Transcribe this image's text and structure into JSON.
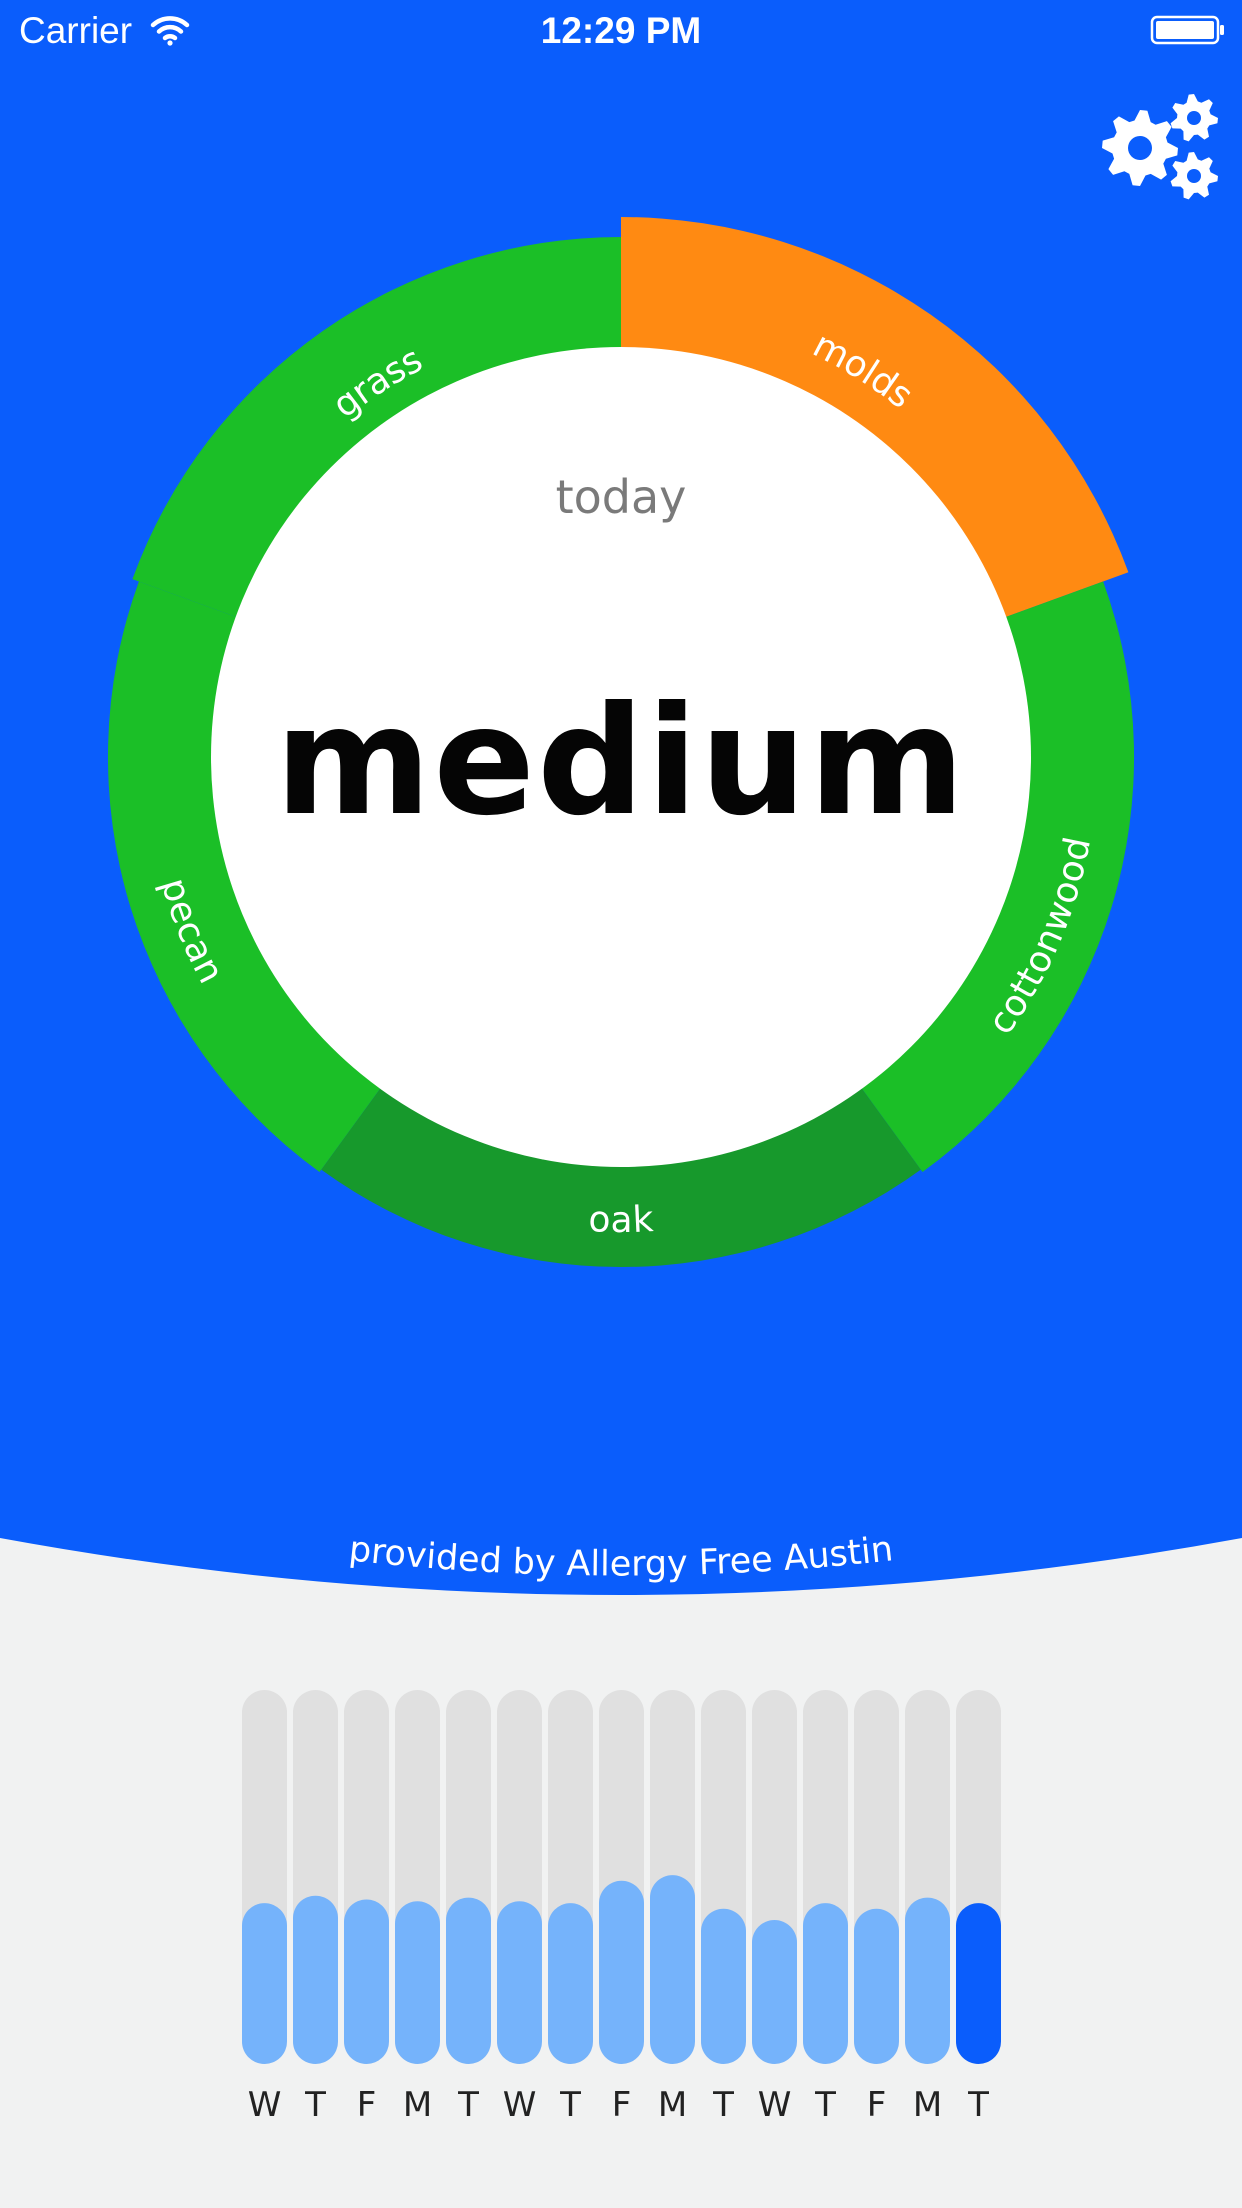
{
  "status_bar": {
    "carrier": "Carrier",
    "time": "12:29 PM"
  },
  "theme": {
    "background_blue": "#0a5dfc",
    "allergen_green": "#1bbf27",
    "allergen_dark_green": "#17992c",
    "allergen_orange": "#ff8a12",
    "bar_track": "#e0e0e0",
    "bar_light_blue": "#75b3fb",
    "bar_today_blue": "#0a5dfc",
    "footer_bg": "#f1f2f2"
  },
  "settings": {
    "icon": "gear-icon"
  },
  "forecast": {
    "day_label": "today",
    "level": "medium",
    "allergens": [
      {
        "name": "grass",
        "level": "low",
        "color": "#1bbf27"
      },
      {
        "name": "molds",
        "level": "high",
        "color": "#ff8a12"
      },
      {
        "name": "cottonwood",
        "level": "low",
        "color": "#1bbf27"
      },
      {
        "name": "oak",
        "level": "low",
        "color": "#17992c"
      },
      {
        "name": "pecan",
        "level": "low",
        "color": "#1bbf27"
      }
    ]
  },
  "source": {
    "text": "provided by Allergy Free Austin"
  },
  "history": {
    "days": [
      {
        "label": "W",
        "level": 0.43,
        "today": false
      },
      {
        "label": "T",
        "level": 0.45,
        "today": false
      },
      {
        "label": "F",
        "level": 0.44,
        "today": false
      },
      {
        "label": "M",
        "level": 0.435,
        "today": false
      },
      {
        "label": "T",
        "level": 0.445,
        "today": false
      },
      {
        "label": "W",
        "level": 0.435,
        "today": false
      },
      {
        "label": "T",
        "level": 0.43,
        "today": false
      },
      {
        "label": "F",
        "level": 0.49,
        "today": false
      },
      {
        "label": "M",
        "level": 0.505,
        "today": false
      },
      {
        "label": "T",
        "level": 0.415,
        "today": false
      },
      {
        "label": "W",
        "level": 0.385,
        "today": false
      },
      {
        "label": "T",
        "level": 0.43,
        "today": false
      },
      {
        "label": "F",
        "level": 0.415,
        "today": false
      },
      {
        "label": "M",
        "level": 0.445,
        "today": false
      },
      {
        "label": "T",
        "level": 0.43,
        "today": true
      }
    ]
  }
}
